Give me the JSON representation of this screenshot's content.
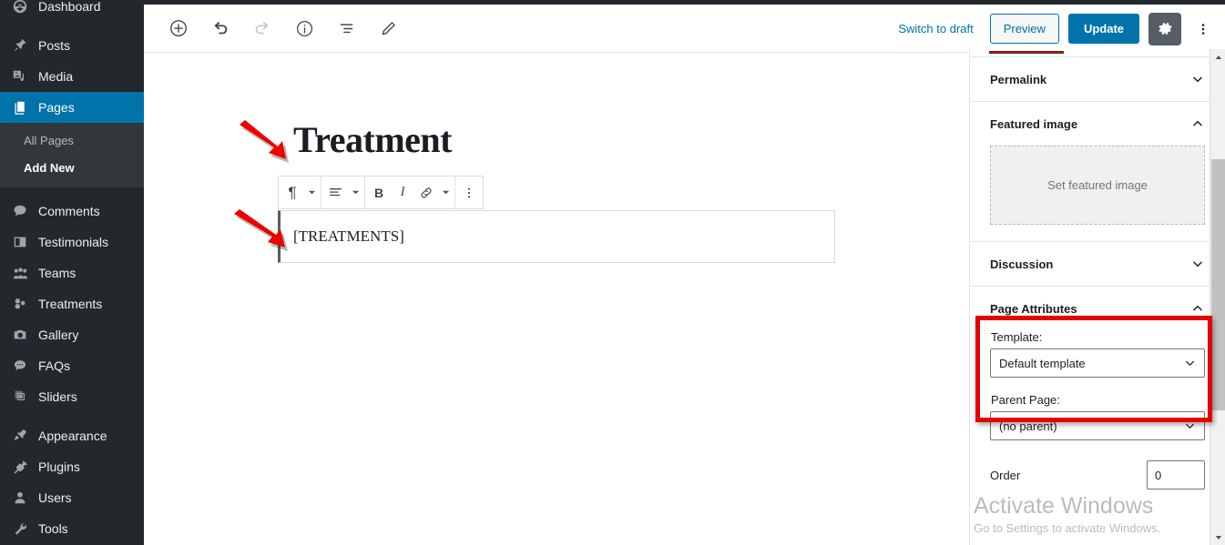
{
  "sidebar": {
    "items": [
      {
        "label": "Dashboard",
        "icon": "dashboard-icon",
        "name": "dashboard"
      },
      {
        "label": "Posts",
        "icon": "pin-icon",
        "name": "posts"
      },
      {
        "label": "Media",
        "icon": "media-icon",
        "name": "media"
      },
      {
        "label": "Pages",
        "icon": "pages-icon",
        "name": "pages",
        "current": true
      },
      {
        "label": "Comments",
        "icon": "comment-icon",
        "name": "comments"
      },
      {
        "label": "Testimonials",
        "icon": "testimonial-icon",
        "name": "testimonials"
      },
      {
        "label": "Teams",
        "icon": "teams-icon",
        "name": "teams"
      },
      {
        "label": "Treatments",
        "icon": "treatments-icon",
        "name": "treatments"
      },
      {
        "label": "Gallery",
        "icon": "camera-icon",
        "name": "gallery"
      },
      {
        "label": "FAQs",
        "icon": "faq-icon",
        "name": "faqs"
      },
      {
        "label": "Sliders",
        "icon": "sliders-icon",
        "name": "sliders"
      },
      {
        "label": "Appearance",
        "icon": "brush-icon",
        "name": "appearance"
      },
      {
        "label": "Plugins",
        "icon": "plug-icon",
        "name": "plugins"
      },
      {
        "label": "Users",
        "icon": "user-icon",
        "name": "users"
      },
      {
        "label": "Tools",
        "icon": "wrench-icon",
        "name": "tools"
      }
    ],
    "submenu": [
      {
        "label": "All Pages",
        "name": "all-pages"
      },
      {
        "label": "Add New",
        "name": "add-new",
        "current": true
      }
    ],
    "accent_color": "#0073aa",
    "background_color": "#23282d"
  },
  "header": {
    "tools": [
      {
        "name": "add-block-icon",
        "label": "Add block"
      },
      {
        "name": "undo-icon",
        "label": "Undo"
      },
      {
        "name": "redo-icon",
        "label": "Redo",
        "disabled": true
      },
      {
        "name": "info-icon",
        "label": "Details"
      },
      {
        "name": "list-view-icon",
        "label": "List view"
      },
      {
        "name": "pencil-icon",
        "label": "Edit"
      }
    ],
    "switch_to_draft": "Switch to draft",
    "preview": "Preview",
    "update": "Update",
    "settings_icon": "gear-icon",
    "more_icon": "kebab-menu-icon"
  },
  "editor": {
    "title": "Treatment",
    "paragraph_text": "[TREATMENTS]",
    "block_toolbar": [
      {
        "name": "paragraph-transform-button",
        "glyph": "¶",
        "caret": true
      },
      {
        "name": "align-button",
        "glyph": "align",
        "caret": true
      },
      {
        "name": "bold-button",
        "glyph": "B"
      },
      {
        "name": "italic-button",
        "glyph": "I"
      },
      {
        "name": "link-button",
        "glyph": "link"
      },
      {
        "name": "more-rich-text-button",
        "glyph": "caret"
      },
      {
        "name": "block-options-button",
        "glyph": "kebab"
      }
    ]
  },
  "settings": {
    "panels": [
      {
        "name": "permalink",
        "title": "Permalink",
        "expanded": false
      },
      {
        "name": "featured-image",
        "title": "Featured image",
        "expanded": true
      },
      {
        "name": "discussion",
        "title": "Discussion",
        "expanded": false
      },
      {
        "name": "page-attributes",
        "title": "Page Attributes",
        "expanded": true
      }
    ],
    "featured_image_placeholder": "Set featured image",
    "template_label": "Template:",
    "template_value": "Default template",
    "parent_page_label": "Parent Page:",
    "parent_page_value": "(no parent)",
    "order_label": "Order",
    "order_value": "0",
    "highlight_color": "#e60000",
    "tab_indicator_color": "#8b1a1a"
  },
  "watermark": {
    "title": "Activate Windows",
    "subtitle": "Go to Settings to activate Windows."
  }
}
